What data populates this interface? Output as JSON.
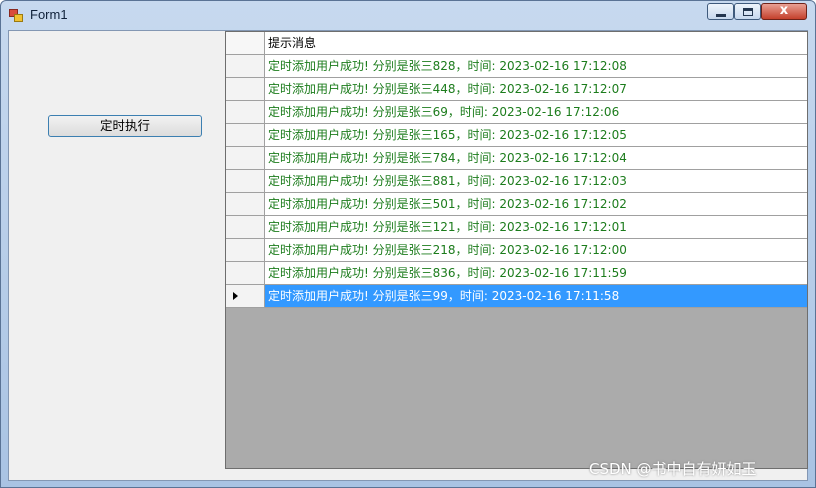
{
  "window": {
    "title": "Form1"
  },
  "controls": {
    "minimize": "minimize",
    "maximize": "maximize",
    "close": "x"
  },
  "button": {
    "label": "定时执行"
  },
  "grid": {
    "column_header": "提示消息",
    "selected_row_index": 10,
    "rows": [
      "定时添加用户成功! 分别是张三828，时间: 2023-02-16 17:12:08",
      "定时添加用户成功! 分别是张三448，时间: 2023-02-16 17:12:07",
      "定时添加用户成功! 分别是张三69，时间: 2023-02-16 17:12:06",
      "定时添加用户成功! 分别是张三165，时间: 2023-02-16 17:12:05",
      "定时添加用户成功! 分别是张三784，时间: 2023-02-16 17:12:04",
      "定时添加用户成功! 分别是张三881，时间: 2023-02-16 17:12:03",
      "定时添加用户成功! 分别是张三501，时间: 2023-02-16 17:12:02",
      "定时添加用户成功! 分别是张三121，时间: 2023-02-16 17:12:01",
      "定时添加用户成功! 分别是张三218，时间: 2023-02-16 17:12:00",
      "定时添加用户成功! 分别是张三836，时间: 2023-02-16 17:11:59",
      "定时添加用户成功! 分别是张三99，时间: 2023-02-16 17:11:58"
    ]
  },
  "watermark": "CSDN @书中自有妍如玉"
}
